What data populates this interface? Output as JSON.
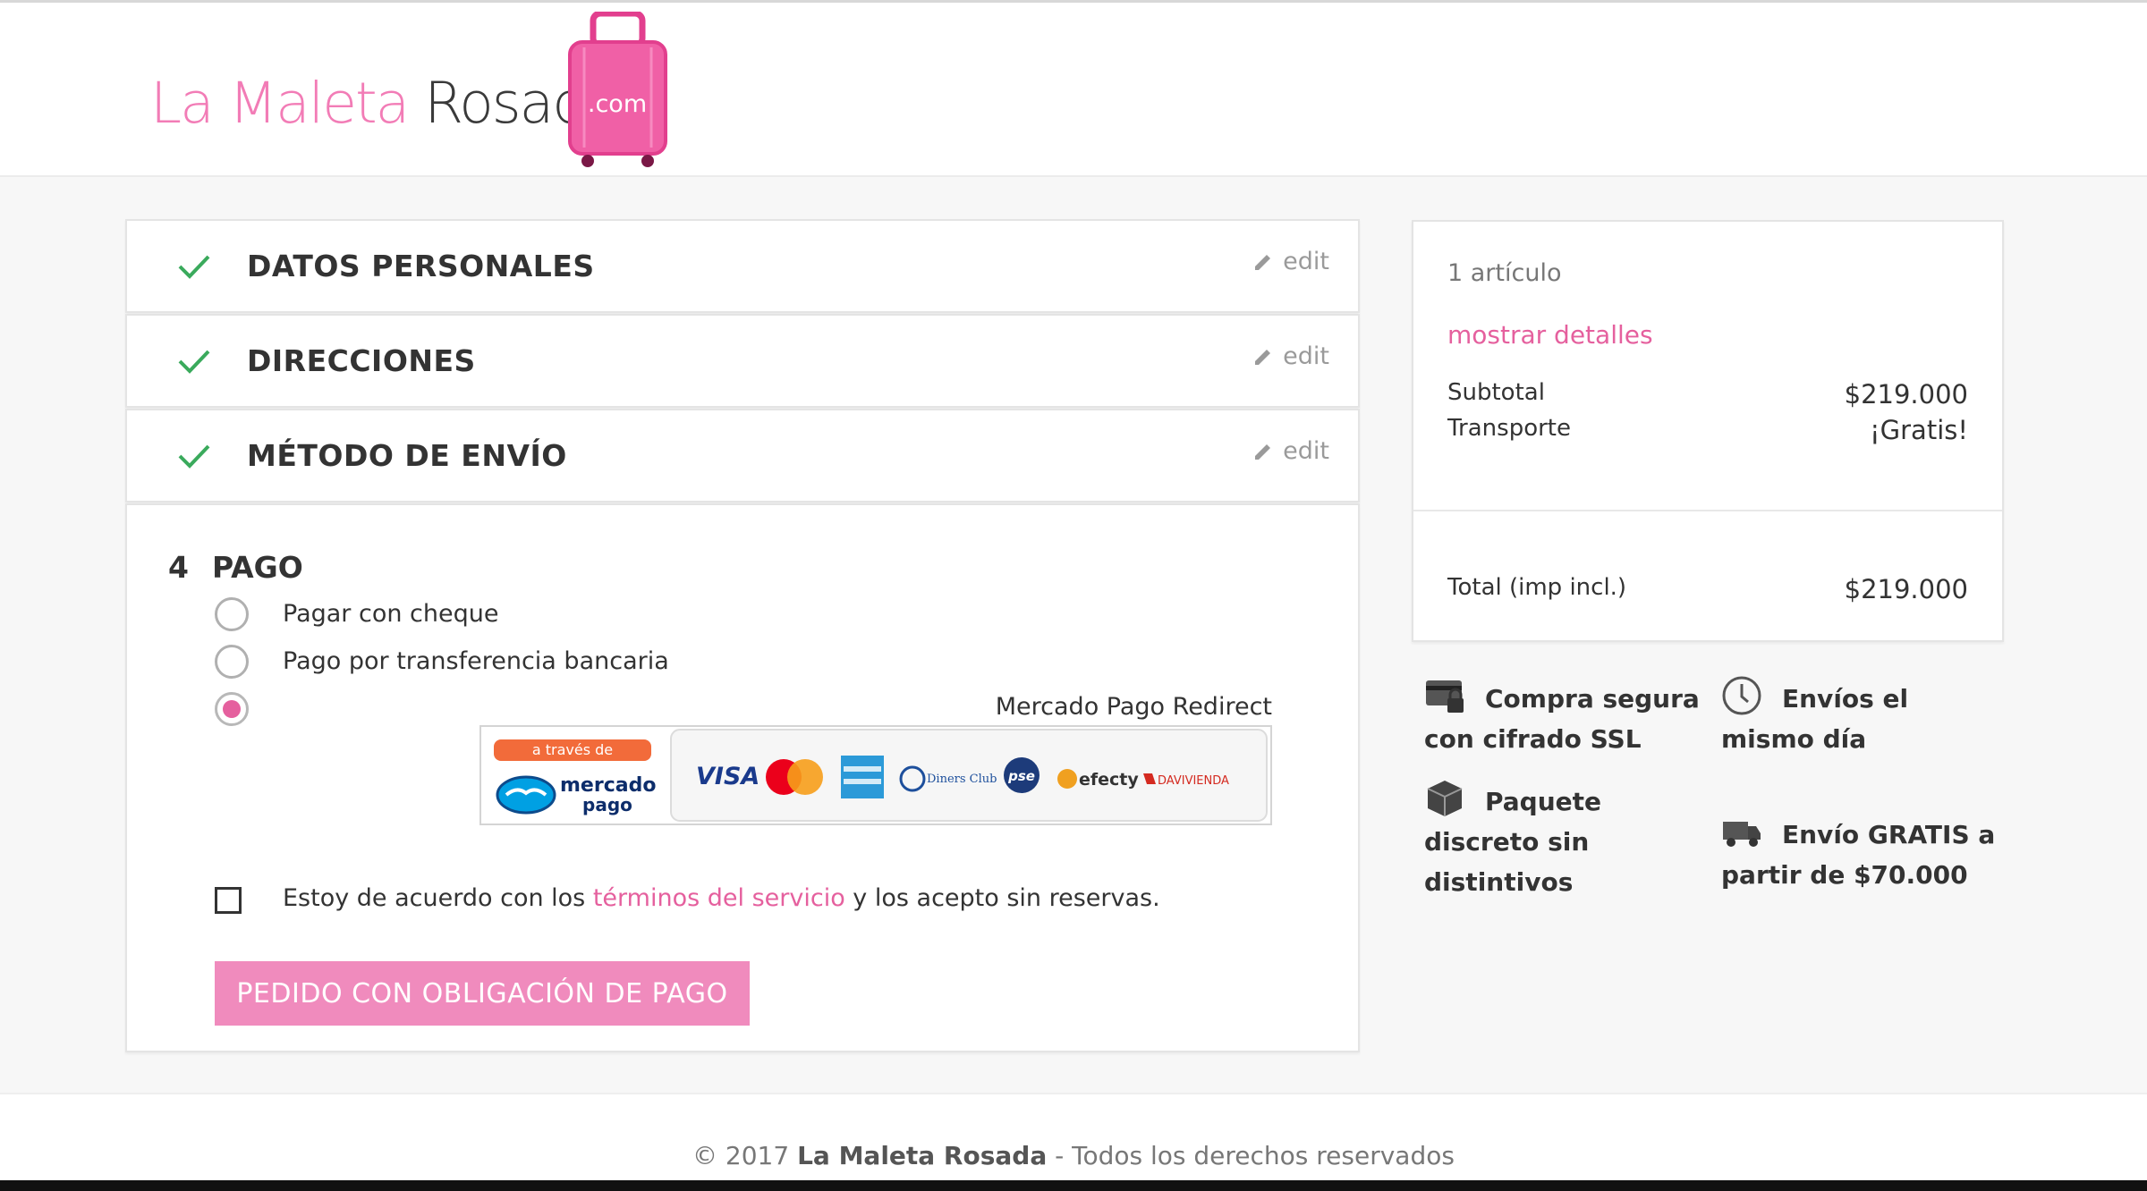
{
  "brand": {
    "logo_part1": "La Maleta ",
    "logo_part2": "Rosada",
    "logo_badge": ".com",
    "pink": "#f27cb6",
    "accent": "#e5609e"
  },
  "steps": [
    {
      "title": "DATOS PERSONALES",
      "edit": "edit",
      "done": true
    },
    {
      "title": "DIRECCIONES",
      "edit": "edit",
      "done": true
    },
    {
      "title": "MÉTODO DE ENVÍO",
      "edit": "edit",
      "done": true
    }
  ],
  "payment": {
    "number": "4",
    "title": "PAGO",
    "options": [
      {
        "label": "Pagar con cheque",
        "selected": false
      },
      {
        "label": "Pago por transferencia bancaria",
        "selected": false
      },
      {
        "label": "",
        "selected": true
      }
    ],
    "mp_name": "Mercado Pago Redirect",
    "mp_banner": {
      "tag": "a través de",
      "brand_line1": "mercado",
      "brand_line2": "pago",
      "cards": [
        "VISA",
        "MasterCard",
        "American Express",
        "Diners Club",
        "pse",
        "efecty",
        "DAVIVIENDA"
      ]
    },
    "terms_before": "Estoy de acuerdo con los ",
    "terms_link": "términos del servicio",
    "terms_after": " y los acepto sin reservas.",
    "terms_checked": false,
    "order_button": "PEDIDO CON OBLIGACIÓN DE PAGO"
  },
  "summary": {
    "count": "1 artículo",
    "details_link": "mostrar detalles",
    "subtotal_label": "Subtotal",
    "subtotal_value": "$219.000",
    "shipping_label": "Transporte",
    "shipping_value": "¡Gratis!",
    "total_label": "Total (imp incl.)",
    "total_value": "$219.000"
  },
  "features": [
    {
      "icon": "credit-card-lock-icon",
      "line1": "Compra segura",
      "line2": "con cifrado SSL"
    },
    {
      "icon": "clock-icon",
      "line1": "Envíos el",
      "line2": "mismo día"
    },
    {
      "icon": "package-icon",
      "line1": "Paquete",
      "line2": "discreto sin",
      "line3": "distintivos"
    },
    {
      "icon": "truck-icon",
      "line1": "Envío GRATIS a",
      "line2": "partir de $70.000"
    }
  ],
  "footer": {
    "prefix": "© 2017 ",
    "brand": "La Maleta Rosada",
    "suffix": " - Todos los derechos reservados"
  }
}
